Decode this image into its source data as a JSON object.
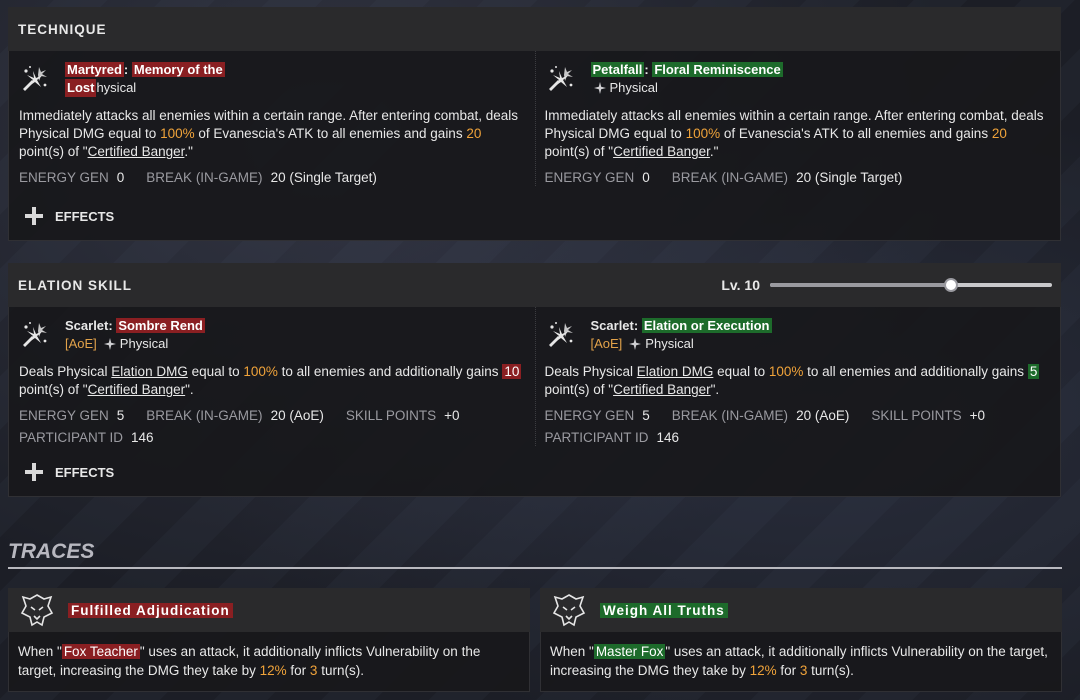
{
  "technique": {
    "title": "TECHNIQUE",
    "left": {
      "name_a": "Martyred",
      "name_sep": ": ",
      "name_b": "Memory of the",
      "name_c": "Lost",
      "type": "hysical",
      "desc_1": "Immediately attacks all enemies within a certain range. After entering combat, deals Physical DMG equal to ",
      "pct": "100%",
      "desc_2": " of Evanescia's ATK to all enemies and gains ",
      "points": "20",
      "desc_3": " point(s) of \"",
      "link": "Certified Banger",
      "desc_4": ".\"",
      "stat1_k": "ENERGY GEN",
      "stat1_v": "0",
      "stat2_k": "BREAK (IN-GAME)",
      "stat2_v": "20 (Single Target)"
    },
    "right": {
      "name_a": "Petalfall",
      "name_sep": ": ",
      "name_b": "Floral Reminiscence",
      "type": "Physical",
      "desc_1": "Immediately attacks all enemies within a certain range. After entering combat, deals Physical DMG equal to ",
      "pct": "100%",
      "desc_2": " of Evanescia's ATK to all enemies and gains ",
      "points": "20",
      "desc_3": " point(s) of \"",
      "link": "Certified Banger",
      "desc_4": ".\"",
      "stat1_k": "ENERGY GEN",
      "stat1_v": "0",
      "stat2_k": "BREAK (IN-GAME)",
      "stat2_v": "20 (Single Target)"
    },
    "effects_label": "EFFECTS"
  },
  "elation": {
    "title": "ELATION SKILL",
    "level_label": "Lv. 10",
    "level": 10,
    "level_max": 15,
    "left": {
      "name_a": "Scarlet: ",
      "name_b": "Sombre Rend",
      "tag": "[AoE]",
      "type": "Physical",
      "desc_1": "Deals Physical ",
      "link1": "Elation DMG",
      "desc_2": " equal to ",
      "pct": "100%",
      "desc_3": " to all enemies and additionally gains ",
      "points": "10",
      "desc_4": "point(s) of \"",
      "link2": "Certified Banger",
      "desc_5": "\".",
      "stat1_k": "ENERGY GEN",
      "stat1_v": "5",
      "stat2_k": "BREAK (IN-GAME)",
      "stat2_v": "20 (AoE)",
      "stat3_k": "SKILL POINTS",
      "stat3_v": "+0",
      "stat4_k": "PARTICIPANT ID",
      "stat4_v": "146"
    },
    "right": {
      "name_a": "Scarlet: ",
      "name_b": "Elation or Execution",
      "tag": "[AoE]",
      "type": "Physical",
      "desc_1": "Deals Physical ",
      "link1": "Elation DMG",
      "desc_2": " equal to ",
      "pct": "100%",
      "desc_3": " to all enemies and additionally gains ",
      "points": "5",
      "desc_4": "point(s) of \"",
      "link2": "Certified Banger",
      "desc_5": "\".",
      "stat1_k": "ENERGY GEN",
      "stat1_v": "5",
      "stat2_k": "BREAK (IN-GAME)",
      "stat2_v": "20 (AoE)",
      "stat3_k": "SKILL POINTS",
      "stat3_v": "+0",
      "stat4_k": "PARTICIPANT ID",
      "stat4_v": "146"
    },
    "effects_label": "EFFECTS"
  },
  "traces": {
    "title": "TRACES",
    "left": {
      "name": "Fulfilled Adjudication",
      "desc_1": "When \"",
      "char": "Fox Teacher",
      "desc_2": "\" uses an attack, it additionally inflicts Vulnerability on the target, increasing the DMG they take by ",
      "pct": "12%",
      "desc_3": " for ",
      "turns": "3",
      "desc_4": " turn(s)."
    },
    "right": {
      "name": "Weigh All Truths",
      "desc_1": "When \"",
      "char": "Master Fox",
      "desc_2": "\" uses an attack, it additionally inflicts Vulnerability on the target, increasing the DMG they take by ",
      "pct": "12%",
      "desc_3": " for ",
      "turns": "3",
      "desc_4": " turn(s)."
    }
  },
  "colors": {
    "accent_orange": "#f0a33a",
    "highlight_red": "#8a1f22",
    "highlight_green": "#1d6b2b"
  },
  "icons": {
    "ability": "burst-slash-icon",
    "physical": "physical-element-icon",
    "trace": "wolf-emblem-icon",
    "effects": "plus-icon"
  }
}
